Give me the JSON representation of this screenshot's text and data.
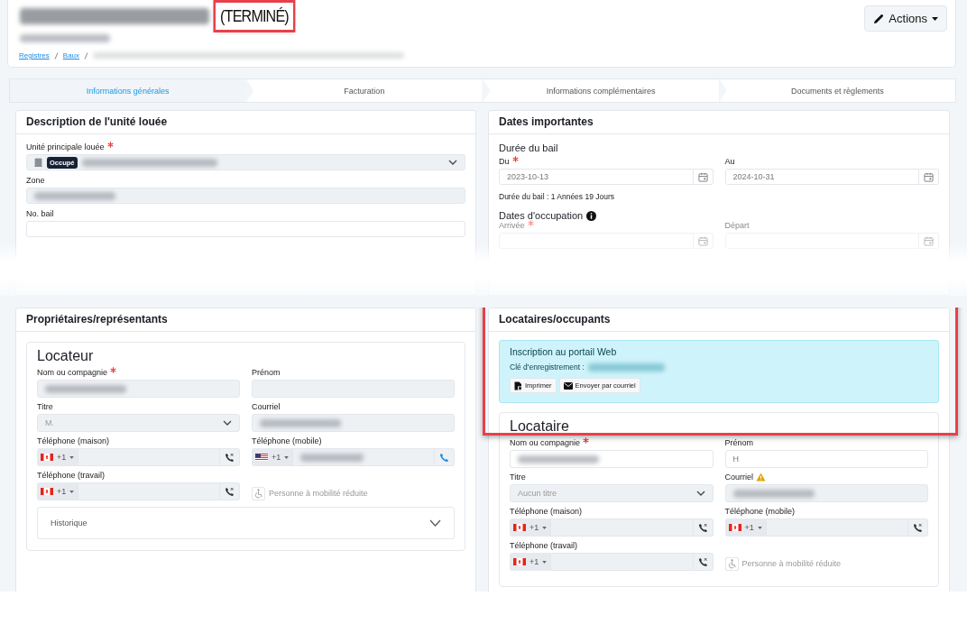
{
  "header": {
    "status": "(TERMINÉ)",
    "status_highlighted": true,
    "title_redacted": true,
    "subtitle_redacted": true,
    "breadcrumb": [
      "Registres",
      "Baux"
    ],
    "actions_button": "Actions"
  },
  "steps": [
    {
      "label": "Informations générales",
      "selected": true
    },
    {
      "label": "Facturation",
      "selected": false
    },
    {
      "label": "Informations complémentaires",
      "selected": false
    },
    {
      "label": "Documents et règlements",
      "selected": false
    }
  ],
  "unit_card": {
    "title": "Description de l'unité louée",
    "fields": [
      {
        "kind": "select",
        "label": "Unité principale louée",
        "required": true,
        "disabled": true,
        "badge": "Occupé",
        "redacted": true
      },
      {
        "kind": "text",
        "label": "Zone",
        "disabled": true,
        "redacted": true
      },
      {
        "kind": "text",
        "label": "No. bail",
        "disabled": false
      }
    ]
  },
  "dates_card": {
    "title": "Dates importantes",
    "lease_heading": "Durée du bail",
    "lease_fields": [
      {
        "kind": "date",
        "label": "Du",
        "required": true,
        "value": "2023-10-13"
      },
      {
        "kind": "date",
        "label": "Au",
        "value": "2024-10-31"
      }
    ],
    "duration": "Durée du bail : 1 Années 19 Jours",
    "occupancy_heading": "Dates d'occupation",
    "occupancy_fields": [
      {
        "kind": "date",
        "label": "Arrivée",
        "required": true
      },
      {
        "kind": "date",
        "label": "Départ"
      }
    ]
  },
  "owners_card": {
    "title": "Propriétaires/représentants",
    "subtitle": "Locateur",
    "fields": [
      {
        "kind": "text",
        "label": "Nom ou compagnie",
        "required": true,
        "disabled": true,
        "redacted": true
      },
      {
        "kind": "text",
        "label": "Prénom",
        "disabled": true
      },
      {
        "kind": "select",
        "label": "Titre",
        "value": "M.",
        "disabled": true
      },
      {
        "kind": "text",
        "label": "Courriel",
        "disabled": true,
        "redacted": true
      },
      {
        "kind": "phone",
        "label": "Téléphone (maison)",
        "flag": {
          "kind": "ca"
        },
        "code": "+1",
        "call_enabled": false
      },
      {
        "kind": "phone",
        "label": "Téléphone (mobile)",
        "flag": {
          "kind": "us"
        },
        "code": "+1",
        "redacted": true,
        "call_enabled": true
      },
      {
        "kind": "phone",
        "label": "Téléphone (travail)",
        "flag": {
          "kind": "ca"
        },
        "code": "+1",
        "call_enabled": false
      },
      {
        "kind": "checkbox",
        "label": "Personne à mobilité réduite",
        "checked": false,
        "disabled": true
      }
    ],
    "history": {
      "label": "Historique",
      "expanded": false
    }
  },
  "tenants_card": {
    "title": "Locataires/occupants",
    "highlighted": true,
    "portal": {
      "title": "Inscription au portail Web",
      "key_label": "Clé d'enregistrement :",
      "key_redacted": true,
      "buttons": [
        {
          "kind": "print",
          "label": "Imprimer"
        },
        {
          "kind": "email",
          "label": "Envoyer par courriel"
        }
      ]
    },
    "subtitle": "Locataire",
    "fields": [
      {
        "kind": "text",
        "label": "Nom ou compagnie",
        "required": true,
        "disabled": false,
        "redacted": true
      },
      {
        "kind": "text",
        "label": "Prénom",
        "disabled": false,
        "value": "H"
      },
      {
        "kind": "select",
        "label": "Titre",
        "value": "Aucun titre",
        "disabled": true
      },
      {
        "kind": "text",
        "label": "Courriel",
        "warning": true,
        "disabled": true,
        "redacted": true
      },
      {
        "kind": "phone",
        "label": "Téléphone (maison)",
        "flag": {
          "kind": "ca"
        },
        "code": "+1",
        "call_enabled": false
      },
      {
        "kind": "phone",
        "label": "Téléphone (mobile)",
        "flag": {
          "kind": "ca"
        },
        "code": "+1",
        "call_enabled": false
      },
      {
        "kind": "phone",
        "label": "Téléphone (travail)",
        "flag": {
          "kind": "ca"
        },
        "code": "+1",
        "call_enabled": false
      },
      {
        "kind": "checkbox",
        "label": "Personne à mobilité réduite",
        "checked": false,
        "disabled": true
      }
    ]
  }
}
